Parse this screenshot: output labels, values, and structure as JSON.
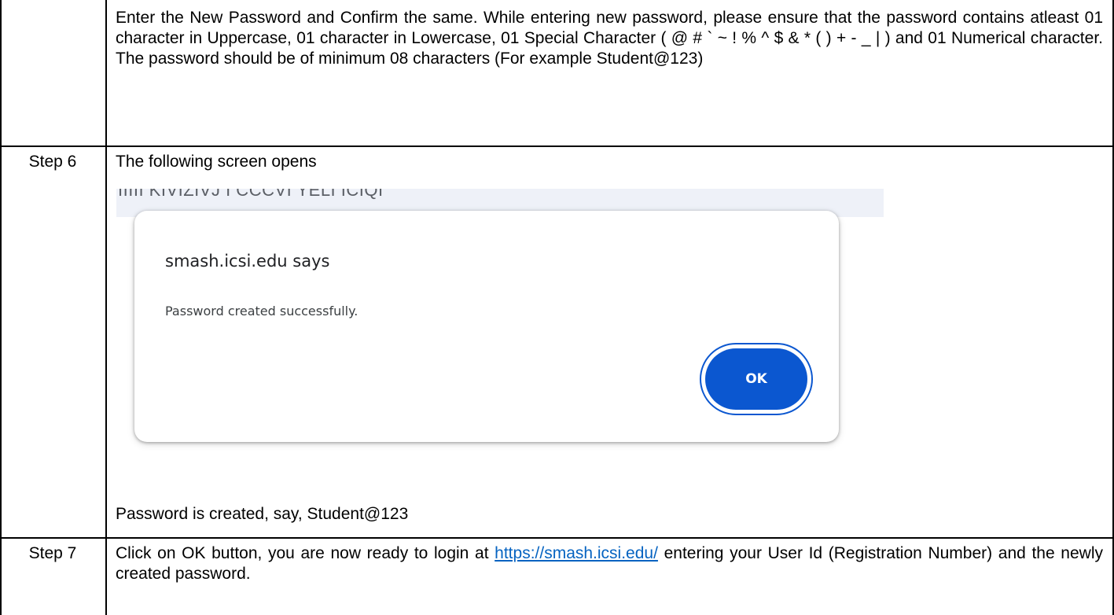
{
  "rows": [
    {
      "label": "",
      "text": "Enter the New Password and Confirm the same. While entering new password, please ensure that the password contains atleast 01 character in Uppercase, 01 character in Lowercase, 01 Special Character ( @ # ` ~ ! % ^ $ & * ( ) + - _ | ) and 01 Numerical character. The password should be of minimum 08 characters (For example Student@123)"
    },
    {
      "label": "Step 6",
      "intro": "The following screen opens",
      "after": "Password is created, say, Student@123"
    },
    {
      "label": "Step 7",
      "text_before": "Click on OK button, you are now ready to login at ",
      "link": "https://smash.icsi.edu/",
      "text_after": " entering your User Id (Registration Number) and the newly created password."
    }
  ],
  "screenshot": {
    "topbar_text": "IIIII KIVIZIVJ I CCCVI YELI ICIQI",
    "dialog": {
      "title": "smash.icsi.edu says",
      "message": "Password created successfully.",
      "ok_label": "OK"
    }
  },
  "colors": {
    "link": "#0563c1",
    "button": "#0b57d0"
  }
}
